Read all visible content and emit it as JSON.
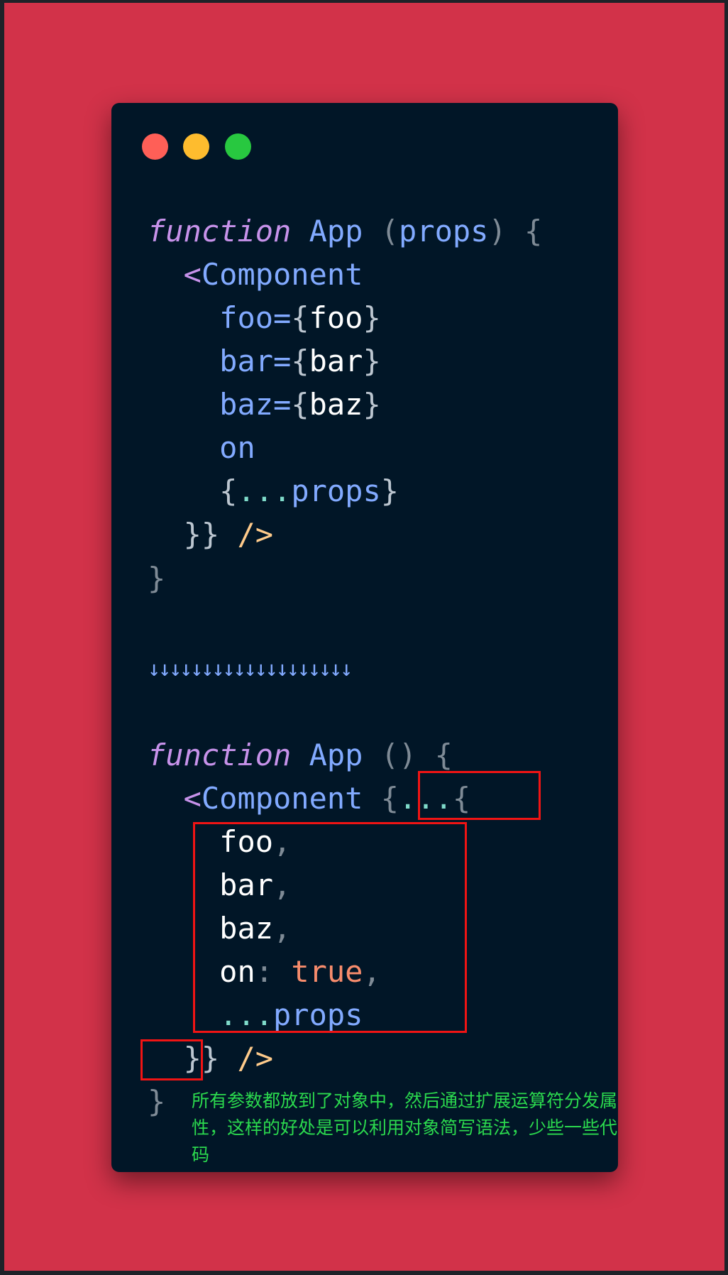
{
  "window": {
    "dots": [
      "close-dot",
      "minimize-dot",
      "maximize-dot"
    ],
    "colors": {
      "background": "#d23249",
      "card": "#011627",
      "close": "#ff5f57",
      "minimize": "#febc2e",
      "maximize": "#28c840",
      "highlight_box": "#f01414",
      "note_text": "#2bd94e"
    }
  },
  "code_before": {
    "l1_kw": "function",
    "l1_name": " App ",
    "l1_open": "(",
    "l1_param": "props",
    "l1_close": ") {",
    "l2_lt": "<",
    "l2_comp": "Component",
    "l3_attr": "foo=",
    "l3_ob": "{",
    "l3_val": "foo",
    "l3_cb": "}",
    "l4_attr": "bar=",
    "l4_ob": "{",
    "l4_val": "bar",
    "l4_cb": "}",
    "l5_attr": "baz=",
    "l5_ob": "{",
    "l5_val": "baz",
    "l5_cb": "}",
    "l6_attr": "on",
    "l7_ob": "{",
    "l7_spread": "...",
    "l7_val": "props",
    "l7_cb": "}",
    "l8_close": "}} ",
    "l8_tagclose": "/>",
    "l9_close": "}"
  },
  "arrows": "↓↓↓↓↓↓↓↓↓↓↓↓↓↓↓↓↓↓↓",
  "code_after": {
    "l1_kw": "function",
    "l1_name": " App ",
    "l1_close": "() {",
    "l2_lt": "<",
    "l2_comp": "Component",
    "l2_ob": " {",
    "l2_spread": "...",
    "l2_ob2": "{",
    "l3_val": "foo",
    "l3_comma": ",",
    "l4_val": "bar",
    "l4_comma": ",",
    "l5_val": "baz",
    "l5_comma": ",",
    "l6_key": "on",
    "l6_colon": ": ",
    "l6_bool": "true",
    "l6_comma": ",",
    "l7_spread": "...",
    "l7_val": "props",
    "l8_close": "}} ",
    "l8_tagclose": "/>",
    "l9_close": "}"
  },
  "note": {
    "text": "所有参数都放到了对象中，然后通过扩展运算符分发属性，这样的好处是可以利用对象简写语法，少些一些代码"
  }
}
